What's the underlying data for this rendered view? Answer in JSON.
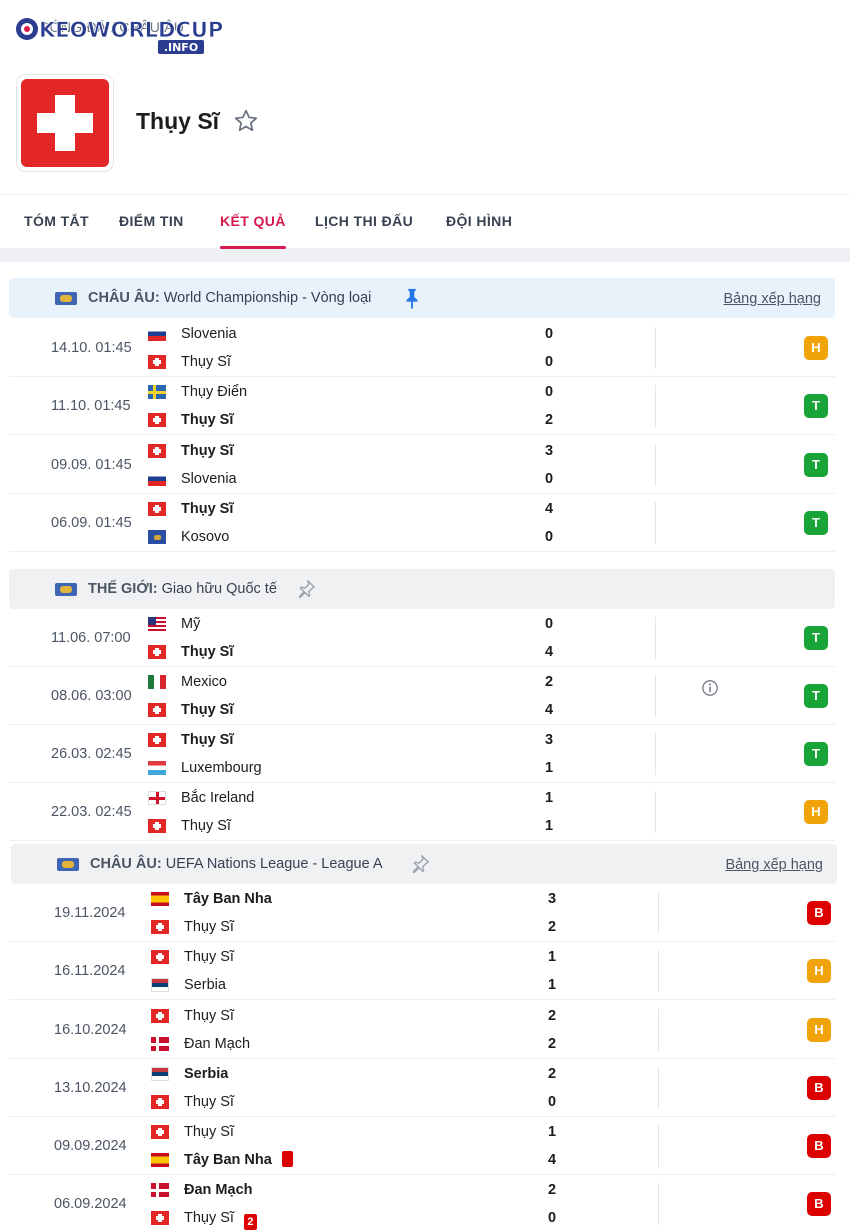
{
  "site": {
    "logo_text": "KEOWORLDCUP",
    "logo_sub": ".INFO"
  },
  "breadcrumb": "BÓNG ĐÁ / CHÂU ÂU",
  "team": {
    "name": "Thụy Sĩ"
  },
  "tabs": [
    "TÓM TẮT",
    "ĐIỂM TIN",
    "KẾT QUẢ",
    "LỊCH THI ĐẤU",
    "ĐỘI HÌNH"
  ],
  "active_tab": "KẾT QUẢ",
  "colors": {
    "accent": "#d7194f",
    "win": "#18a436",
    "draw": "#f0a30a",
    "loss": "#dc0000"
  },
  "leagues": [
    {
      "country": "CHÂU ÂU:",
      "name": "World Championship - Vòng loại",
      "pinned": true,
      "standings": "Bảng xếp hạng"
    },
    {
      "country": "THẾ GIỚI:",
      "name": "Giao hữu Quốc tế",
      "pinned": false,
      "standings": ""
    },
    {
      "country": "CHÂU ÂU:",
      "name": "UEFA Nations League - League A",
      "pinned": false,
      "standings": "Bảng xếp hạng"
    }
  ],
  "matches": [
    {
      "date": "14.10. 01:45",
      "home": "Slovenia",
      "home_flag": "svn",
      "away": "Thụy Sĩ",
      "away_flag": "sui",
      "home_score": "0",
      "away_score": "0",
      "result": "H",
      "bold": ""
    },
    {
      "date": "11.10. 01:45",
      "home": "Thụy Điển",
      "home_flag": "swe",
      "away": "Thụy Sĩ",
      "away_flag": "sui",
      "home_score": "0",
      "away_score": "2",
      "result": "T",
      "bold": "away"
    },
    {
      "date": "09.09. 01:45",
      "home": "Thụy Sĩ",
      "home_flag": "sui",
      "away": "Slovenia",
      "away_flag": "svn",
      "home_score": "3",
      "away_score": "0",
      "result": "T",
      "bold": "home"
    },
    {
      "date": "06.09. 01:45",
      "home": "Thụy Sĩ",
      "home_flag": "sui",
      "away": "Kosovo",
      "away_flag": "kos",
      "home_score": "4",
      "away_score": "0",
      "result": "T",
      "bold": "home"
    },
    {
      "date": "11.06. 07:00",
      "home": "Mỹ",
      "home_flag": "usa",
      "away": "Thụy Sĩ",
      "away_flag": "sui",
      "home_score": "0",
      "away_score": "4",
      "result": "T",
      "bold": "away"
    },
    {
      "date": "08.06. 03:00",
      "home": "Mexico",
      "home_flag": "mex",
      "away": "Thụy Sĩ",
      "away_flag": "sui",
      "home_score": "2",
      "away_score": "4",
      "result": "T",
      "bold": "away",
      "info": true
    },
    {
      "date": "26.03. 02:45",
      "home": "Thụy Sĩ",
      "home_flag": "sui",
      "away": "Luxembourg",
      "away_flag": "lux",
      "home_score": "3",
      "away_score": "1",
      "result": "T",
      "bold": "home"
    },
    {
      "date": "22.03. 02:45",
      "home": "Bắc Ireland",
      "home_flag": "nir",
      "away": "Thụy Sĩ",
      "away_flag": "sui",
      "home_score": "1",
      "away_score": "1",
      "result": "H",
      "bold": ""
    },
    {
      "date": "19.11.2024",
      "home": "Tây Ban Nha",
      "home_flag": "esp",
      "away": "Thụy Sĩ",
      "away_flag": "sui",
      "home_score": "3",
      "away_score": "2",
      "result": "B",
      "bold": "home"
    },
    {
      "date": "16.11.2024",
      "home": "Thụy Sĩ",
      "home_flag": "sui",
      "away": "Serbia",
      "away_flag": "srb",
      "home_score": "1",
      "away_score": "1",
      "result": "H",
      "bold": ""
    },
    {
      "date": "16.10.2024",
      "home": "Thụy Sĩ",
      "home_flag": "sui",
      "away": "Đan Mạch",
      "away_flag": "den",
      "home_score": "2",
      "away_score": "2",
      "result": "H",
      "bold": ""
    },
    {
      "date": "13.10.2024",
      "home": "Serbia",
      "home_flag": "srb",
      "away": "Thụy Sĩ",
      "away_flag": "sui",
      "home_score": "2",
      "away_score": "0",
      "result": "B",
      "bold": "home"
    },
    {
      "date": "09.09.2024",
      "home": "Thụy Sĩ",
      "home_flag": "sui",
      "away": "Tây Ban Nha",
      "away_flag": "esp",
      "home_score": "1",
      "away_score": "4",
      "result": "B",
      "bold": "away",
      "away_red": ""
    },
    {
      "date": "06.09.2024",
      "home": "Đan Mạch",
      "home_flag": "den",
      "away": "Thụy Sĩ",
      "away_flag": "sui",
      "home_score": "2",
      "away_score": "0",
      "result": "B",
      "bold": "home",
      "away_red": "2"
    }
  ]
}
